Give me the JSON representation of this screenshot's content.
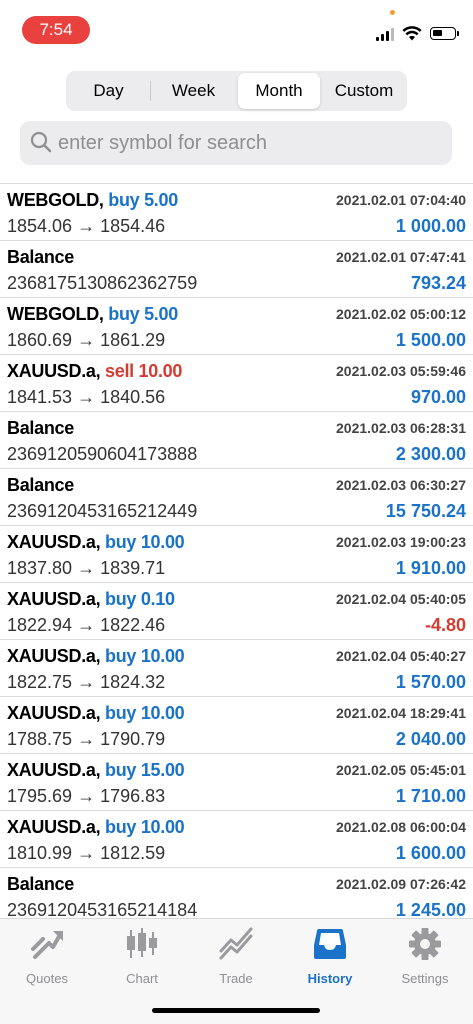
{
  "status": {
    "time": "7:54"
  },
  "period_tabs": [
    {
      "label": "Day"
    },
    {
      "label": "Week"
    },
    {
      "label": "Month",
      "selected": true
    },
    {
      "label": "Custom"
    }
  ],
  "search": {
    "placeholder": "enter symbol for search",
    "value": ""
  },
  "rows": [
    {
      "symbol": "WEBGOLD,",
      "action": "buy 5.00",
      "action_type": "buy",
      "detail": "1854.06 → 1854.46",
      "datetime": "2021.02.01 07:04:40",
      "amount": "1 000.00",
      "sign": "pos"
    },
    {
      "symbol": "Balance",
      "action": "",
      "action_type": "",
      "detail": "2368175130862362759",
      "datetime": "2021.02.01 07:47:41",
      "amount": "793.24",
      "sign": "pos"
    },
    {
      "symbol": "WEBGOLD,",
      "action": "buy 5.00",
      "action_type": "buy",
      "detail": "1860.69 → 1861.29",
      "datetime": "2021.02.02 05:00:12",
      "amount": "1 500.00",
      "sign": "pos"
    },
    {
      "symbol": "XAUUSD.a,",
      "action": "sell 10.00",
      "action_type": "sell",
      "detail": "1841.53 → 1840.56",
      "datetime": "2021.02.03 05:59:46",
      "amount": "970.00",
      "sign": "pos"
    },
    {
      "symbol": "Balance",
      "action": "",
      "action_type": "",
      "detail": "2369120590604173888",
      "datetime": "2021.02.03 06:28:31",
      "amount": "2 300.00",
      "sign": "pos"
    },
    {
      "symbol": "Balance",
      "action": "",
      "action_type": "",
      "detail": "2369120453165212449",
      "datetime": "2021.02.03 06:30:27",
      "amount": "15 750.24",
      "sign": "pos"
    },
    {
      "symbol": "XAUUSD.a,",
      "action": "buy 10.00",
      "action_type": "buy",
      "detail": "1837.80 → 1839.71",
      "datetime": "2021.02.03 19:00:23",
      "amount": "1 910.00",
      "sign": "pos"
    },
    {
      "symbol": "XAUUSD.a,",
      "action": "buy 0.10",
      "action_type": "buy",
      "detail": "1822.94 → 1822.46",
      "datetime": "2021.02.04 05:40:05",
      "amount": "-4.80",
      "sign": "neg"
    },
    {
      "symbol": "XAUUSD.a,",
      "action": "buy 10.00",
      "action_type": "buy",
      "detail": "1822.75 → 1824.32",
      "datetime": "2021.02.04 05:40:27",
      "amount": "1 570.00",
      "sign": "pos"
    },
    {
      "symbol": "XAUUSD.a,",
      "action": "buy 10.00",
      "action_type": "buy",
      "detail": "1788.75 → 1790.79",
      "datetime": "2021.02.04 18:29:41",
      "amount": "2 040.00",
      "sign": "pos"
    },
    {
      "symbol": "XAUUSD.a,",
      "action": "buy 15.00",
      "action_type": "buy",
      "detail": "1795.69 → 1796.83",
      "datetime": "2021.02.05 05:45:01",
      "amount": "1 710.00",
      "sign": "pos"
    },
    {
      "symbol": "XAUUSD.a,",
      "action": "buy 10.00",
      "action_type": "buy",
      "detail": "1810.99 → 1812.59",
      "datetime": "2021.02.08 06:00:04",
      "amount": "1 600.00",
      "sign": "pos"
    },
    {
      "symbol": "Balance",
      "action": "",
      "action_type": "",
      "detail": "2369120453165214184",
      "datetime": "2021.02.09 07:26:42",
      "amount": "1 245.00",
      "sign": "pos"
    }
  ],
  "tabbar": [
    {
      "label": "Quotes",
      "icon": "quotes-icon"
    },
    {
      "label": "Chart",
      "icon": "chart-icon"
    },
    {
      "label": "Trade",
      "icon": "trade-icon"
    },
    {
      "label": "History",
      "icon": "history-icon",
      "active": true
    },
    {
      "label": "Settings",
      "icon": "settings-icon"
    }
  ],
  "colors": {
    "accent": "#1a73c9",
    "negative": "#d63b30",
    "status_pill": "#e8413e",
    "inactive_icon": "#8e8e93"
  }
}
